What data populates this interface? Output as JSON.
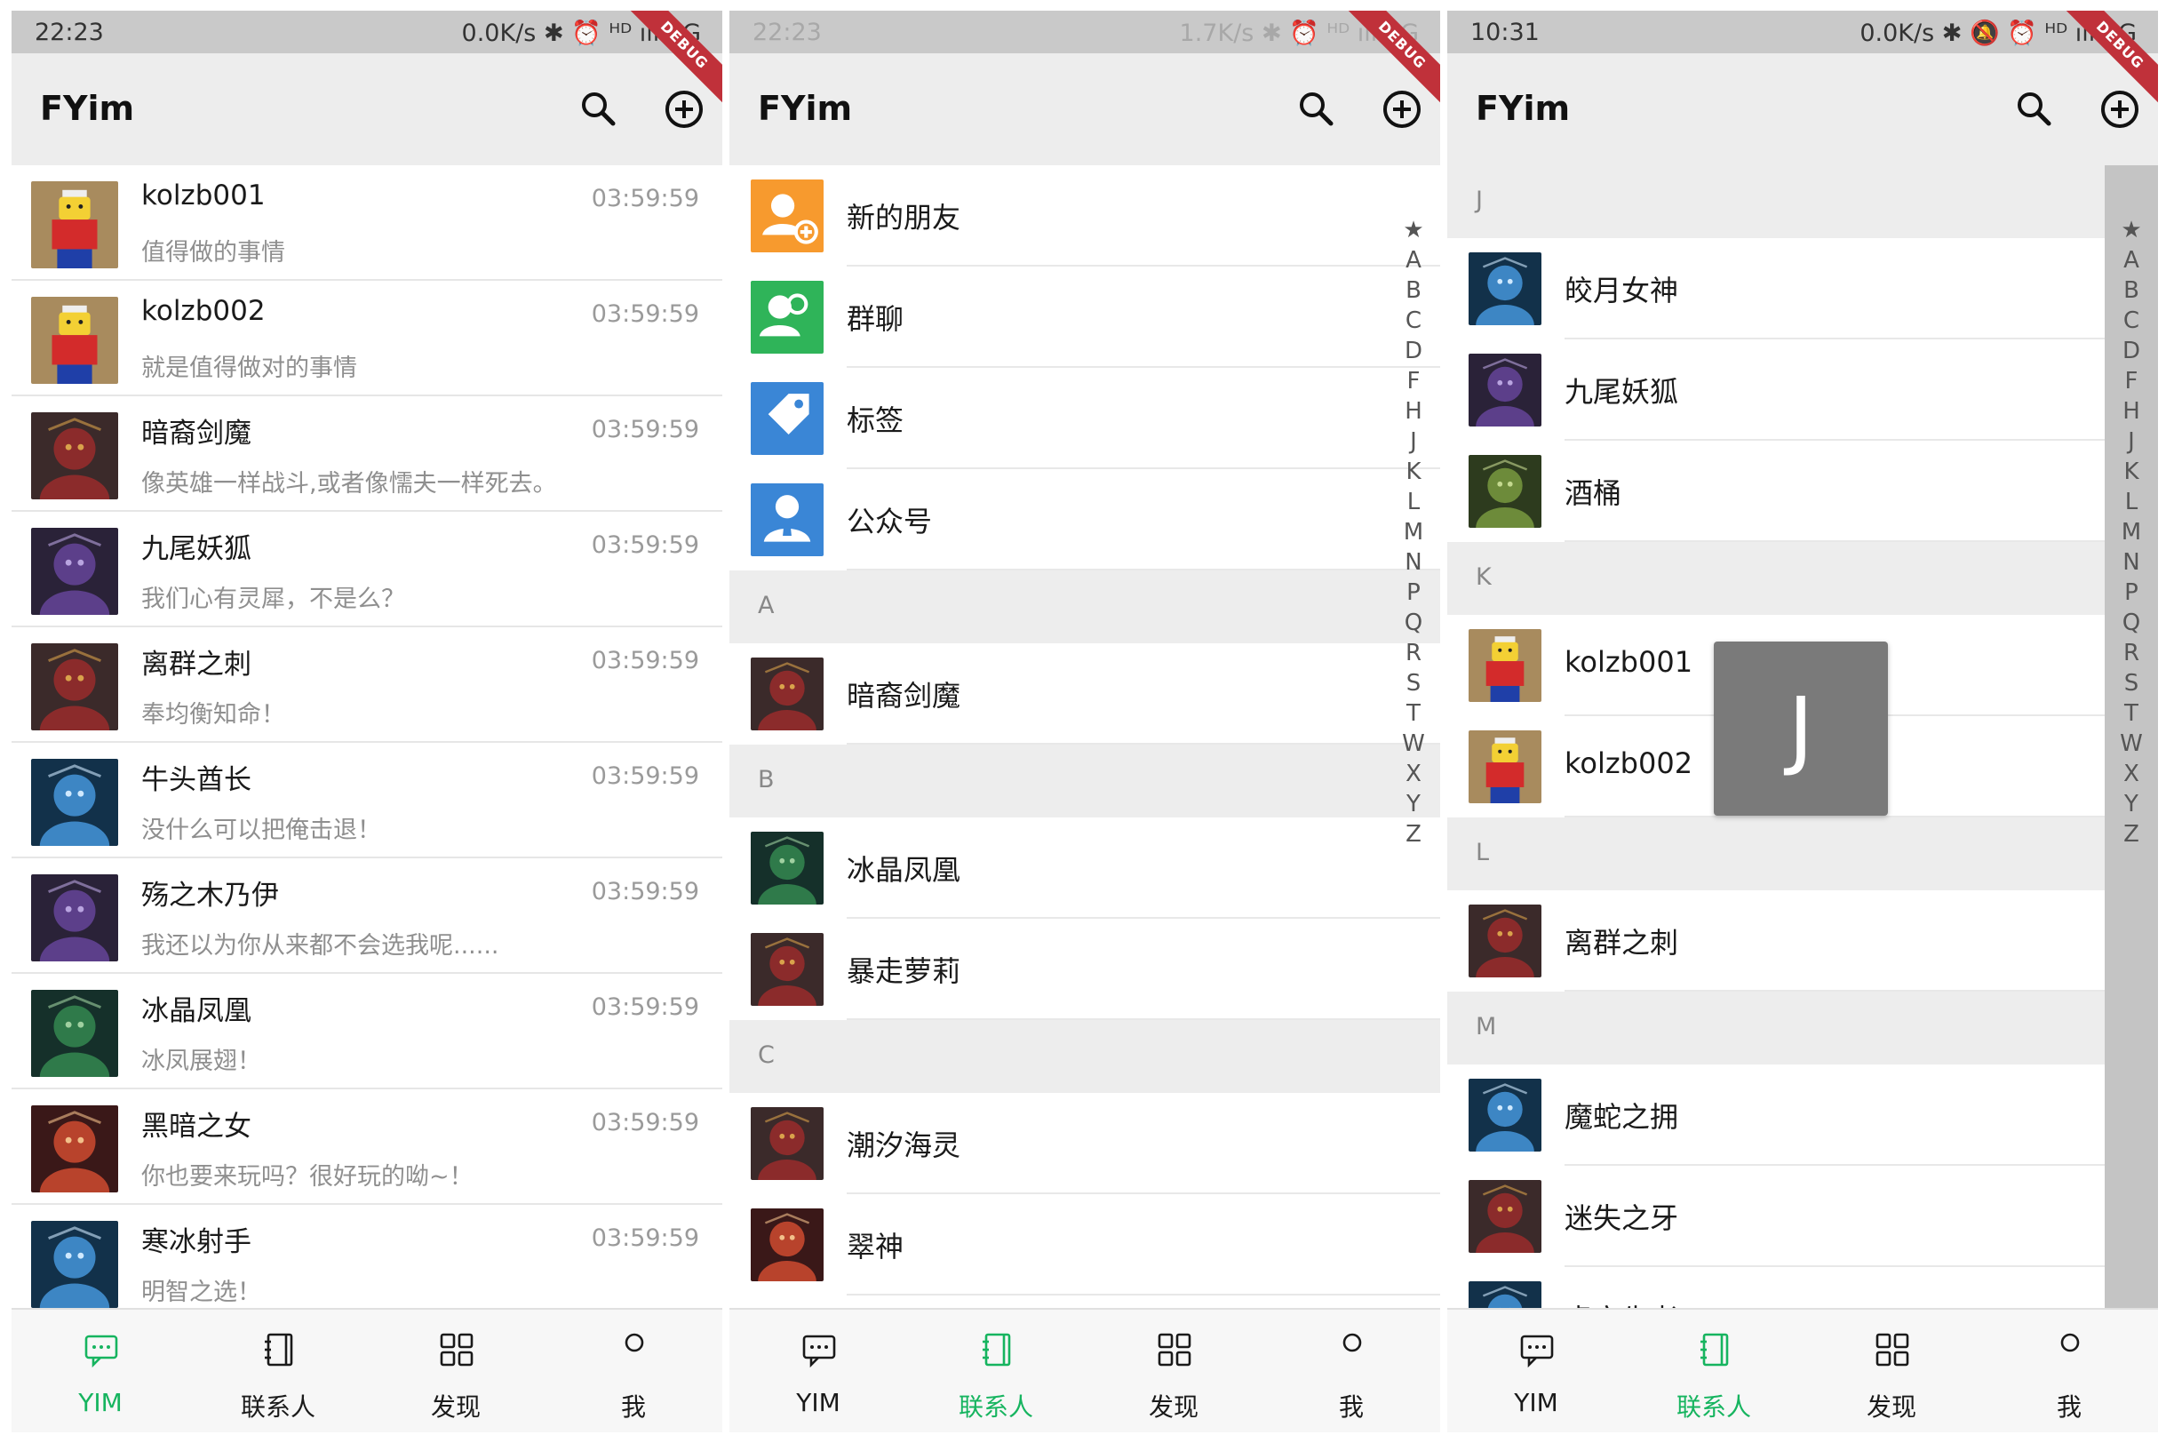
{
  "app_title": "FYim",
  "debug_label": "DEBUG",
  "tabs": [
    {
      "label": "YIM",
      "icon": "chat-bubble-icon"
    },
    {
      "label": "联系人",
      "icon": "contacts-book-icon"
    },
    {
      "label": "发现",
      "icon": "grid-apps-icon"
    },
    {
      "label": "我",
      "icon": "person-icon"
    }
  ],
  "accent_color": "#16b45f",
  "index_letters": [
    "★",
    "A",
    "B",
    "C",
    "D",
    "F",
    "H",
    "J",
    "K",
    "L",
    "M",
    "N",
    "P",
    "Q",
    "R",
    "S",
    "T",
    "W",
    "X",
    "Y",
    "Z"
  ],
  "phones": [
    {
      "status_time": "22:23",
      "status_right": "0.0K/s ✱ ⏰ ᴴᴰ ıll 4G",
      "active_tab": 0,
      "chats": [
        {
          "name": "kolzb001",
          "message": "值得做的事情",
          "time": "03:59:59"
        },
        {
          "name": "kolzb002",
          "message": "就是值得做对的事情",
          "time": "03:59:59"
        },
        {
          "name": "暗裔剑魔",
          "message": "像英雄一样战斗,或者像懦夫一样死去。",
          "time": "03:59:59"
        },
        {
          "name": "九尾妖狐",
          "message": "我们心有灵犀，不是么？",
          "time": "03:59:59"
        },
        {
          "name": "离群之刺",
          "message": "奉均衡知命！",
          "time": "03:59:59"
        },
        {
          "name": "牛头酋长",
          "message": "没什么可以把俺击退！",
          "time": "03:59:59"
        },
        {
          "name": "殇之木乃伊",
          "message": "我还以为你从来都不会选我呢......",
          "time": "03:59:59"
        },
        {
          "name": "冰晶凤凰",
          "message": "冰凤展翅！",
          "time": "03:59:59"
        },
        {
          "name": "黑暗之女",
          "message": "你也要来玩吗？很好玩的呦~！",
          "time": "03:59:59"
        },
        {
          "name": "寒冰射手",
          "message": "明智之选！",
          "time": "03:59:59"
        }
      ]
    },
    {
      "status_time": "22:23",
      "status_right": "1.7K/s ✱ ⏰ ᴴᴰ ıll 4G",
      "active_tab": 1,
      "specials": [
        {
          "name": "新的朋友",
          "icon": "new-friend-icon",
          "color": "#f79a2e"
        },
        {
          "name": "群聊",
          "icon": "group-chat-icon",
          "color": "#2fb459"
        },
        {
          "name": "标签",
          "icon": "tag-icon",
          "color": "#3a86d6"
        },
        {
          "name": "公众号",
          "icon": "official-account-icon",
          "color": "#3a86d6"
        }
      ],
      "sections": [
        {
          "letter": "A",
          "contacts": [
            "暗裔剑魔"
          ]
        },
        {
          "letter": "B",
          "contacts": [
            "冰晶凤凰",
            "暴走萝莉"
          ]
        },
        {
          "letter": "C",
          "contacts": [
            "潮汐海灵",
            "翠神"
          ]
        }
      ]
    },
    {
      "status_time": "10:31",
      "status_right": "0.0K/s ✱ 🔕 ⏰ ᴴᴰ ıll 4G",
      "active_tab": 1,
      "overlay_letter": "J",
      "sections": [
        {
          "letter": "J",
          "contacts": [
            "皎月女神",
            "九尾妖狐",
            "酒桶"
          ]
        },
        {
          "letter": "K",
          "contacts": [
            "kolzb001",
            "kolzb002"
          ]
        },
        {
          "letter": "L",
          "contacts": [
            "离群之刺"
          ]
        },
        {
          "letter": "M",
          "contacts": [
            "魔蛇之拥",
            "迷失之牙",
            "虚空先者"
          ]
        }
      ]
    }
  ]
}
